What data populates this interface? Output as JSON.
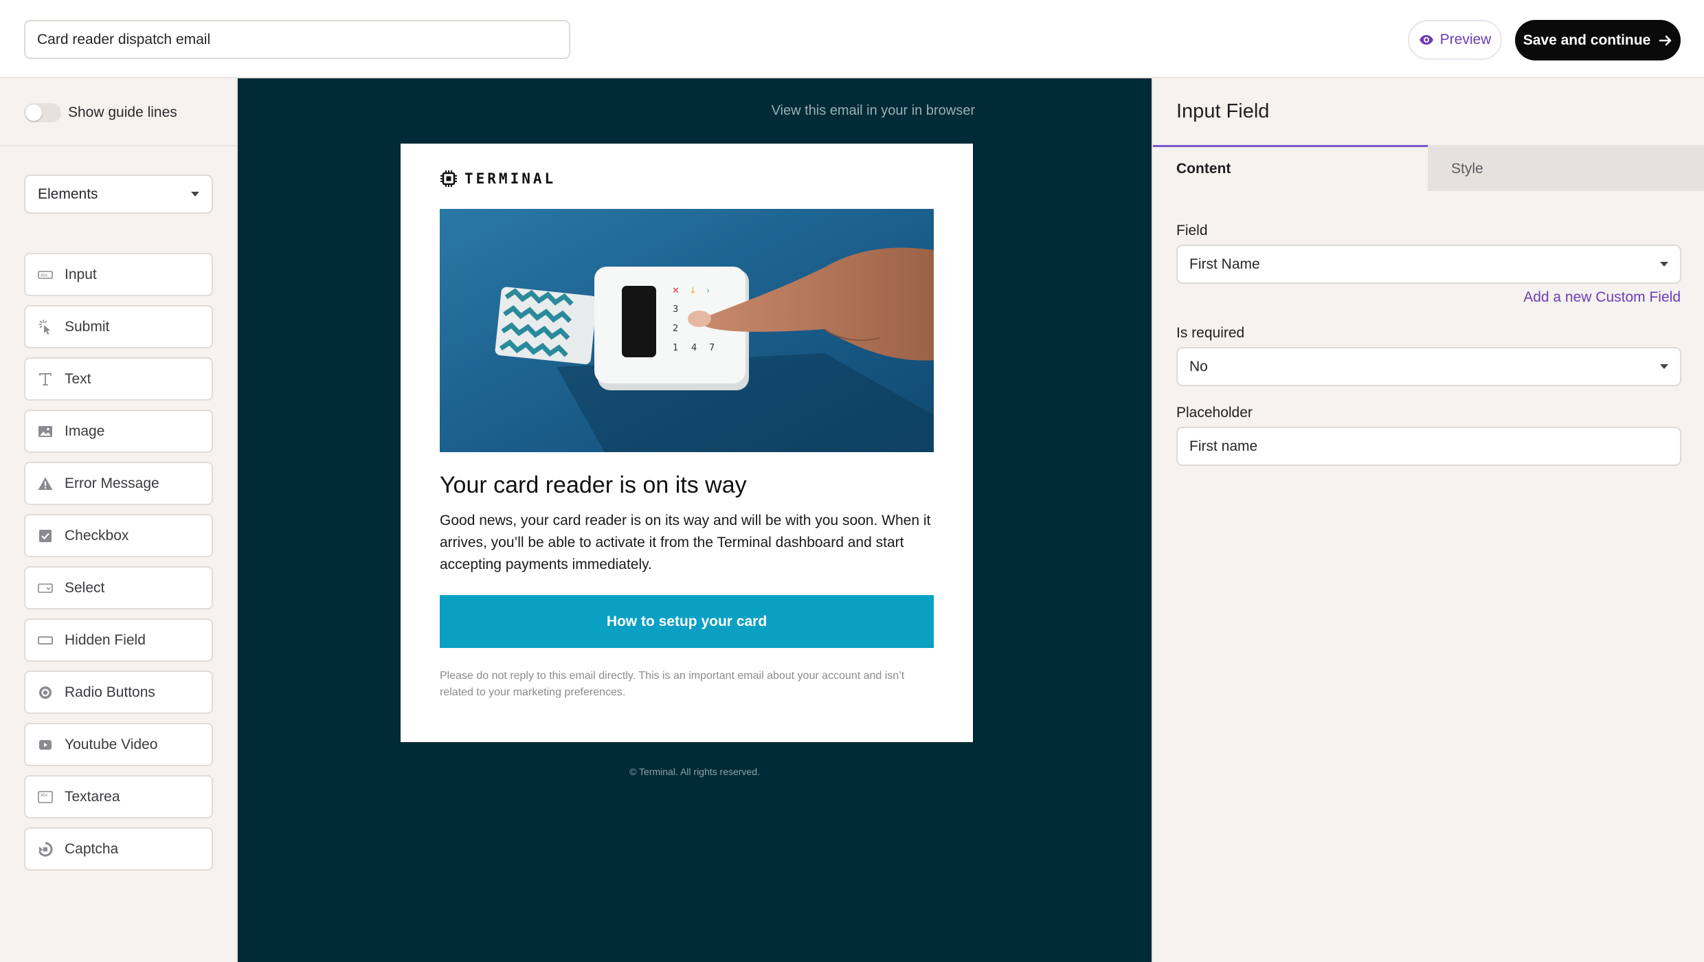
{
  "header": {
    "email_name": "Card reader dispatch email",
    "preview_label": "Preview",
    "save_label": "Save and continue"
  },
  "sidebar": {
    "guide_lines_label": "Show guide lines",
    "guide_lines_on": false,
    "elements_select": "Elements",
    "items": [
      {
        "label": "Input",
        "icon": "input-icon"
      },
      {
        "label": "Submit",
        "icon": "cursor-click-icon"
      },
      {
        "label": "Text",
        "icon": "text-icon"
      },
      {
        "label": "Image",
        "icon": "image-icon"
      },
      {
        "label": "Error Message",
        "icon": "warning-icon"
      },
      {
        "label": "Checkbox",
        "icon": "checkbox-icon"
      },
      {
        "label": "Select",
        "icon": "select-icon"
      },
      {
        "label": "Hidden Field",
        "icon": "hidden-field-icon"
      },
      {
        "label": "Radio Buttons",
        "icon": "radio-icon"
      },
      {
        "label": "Youtube Video",
        "icon": "video-icon"
      },
      {
        "label": "Textarea",
        "icon": "textarea-icon"
      },
      {
        "label": "Captcha",
        "icon": "captcha-icon"
      }
    ]
  },
  "canvas": {
    "background": "#002a36",
    "view_in_browser": "View this email in your in browser",
    "email": {
      "brand": "TERMINAL",
      "headline": "Your card reader is on its way",
      "body": "Good news, your card reader is on its way and will be with you soon. When it arrives, you’ll be able to activate it from the Terminal dashboard and start accepting payments immediately.",
      "cta_label": "How to setup your card",
      "cta_color": "#0aa0c4",
      "disclaimer": "Please do not reply to this email directly. This is an important email about your account and isn’t related to your marketing preferences."
    },
    "footer": "© Terminal. All rights reserved."
  },
  "panel": {
    "title": "Input Field",
    "tabs": [
      "Content",
      "Style"
    ],
    "active_tab": "Content",
    "field_label": "Field",
    "field_value": "First Name",
    "add_custom_field": "Add a new Custom Field",
    "required_label": "Is required",
    "required_value": "No",
    "placeholder_label": "Placeholder",
    "placeholder_value": "First name",
    "accent_color": "#7b56c8"
  }
}
